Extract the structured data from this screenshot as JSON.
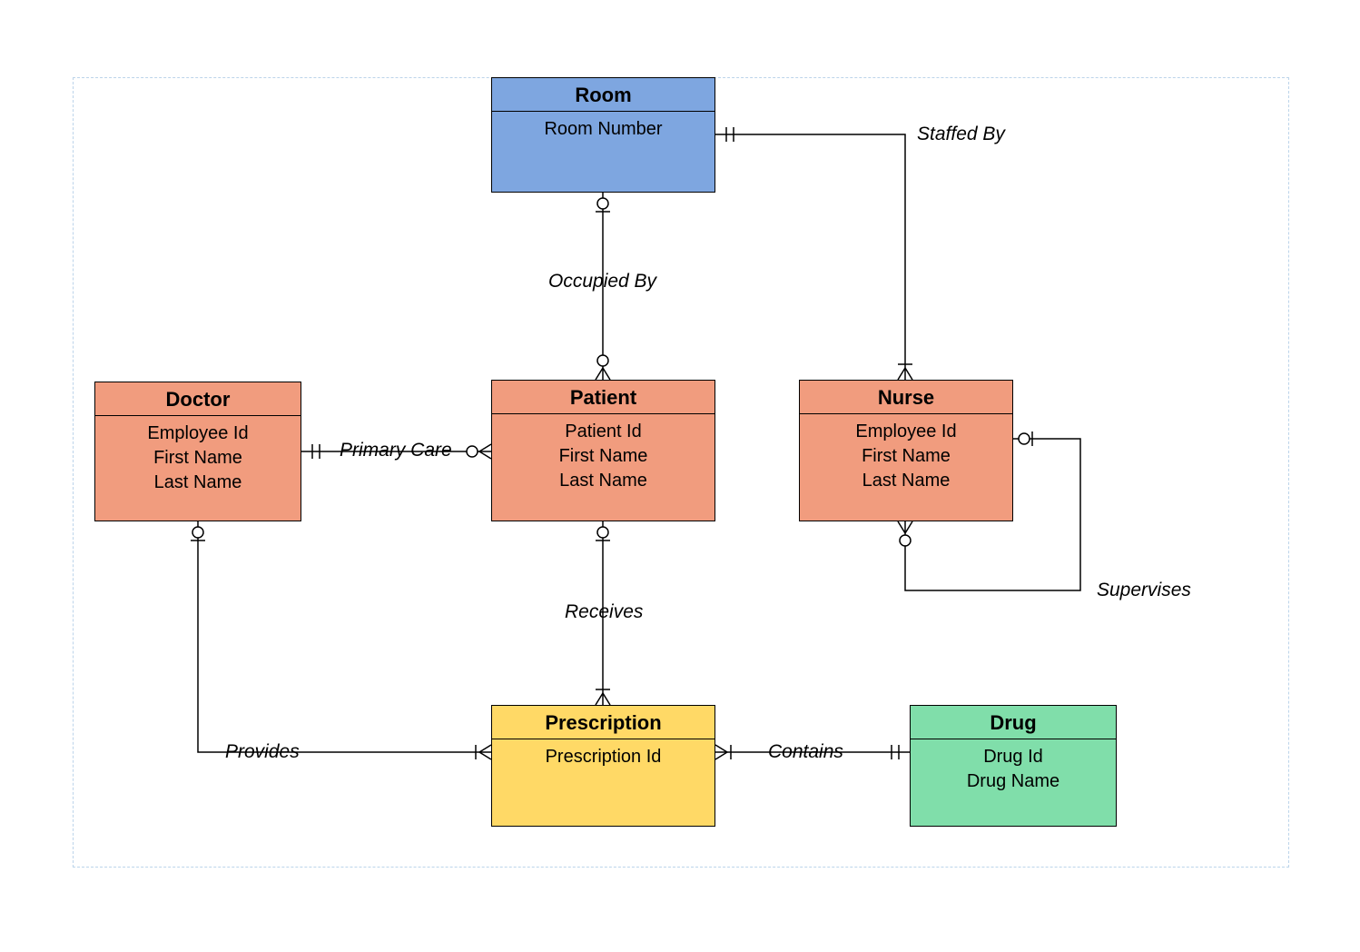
{
  "diagram": {
    "type": "ER diagram",
    "entities": {
      "room": {
        "title": "Room",
        "attributes": [
          "Room Number"
        ],
        "color": "#7ea6e0"
      },
      "doctor": {
        "title": "Doctor",
        "attributes": [
          "Employee Id",
          "First Name",
          "Last Name"
        ],
        "color": "#f19c7e"
      },
      "patient": {
        "title": "Patient",
        "attributes": [
          "Patient Id",
          "First Name",
          "Last Name"
        ],
        "color": "#f19c7e"
      },
      "nurse": {
        "title": "Nurse",
        "attributes": [
          "Employee Id",
          "First Name",
          "Last Name"
        ],
        "color": "#f19c7e"
      },
      "prescription": {
        "title": "Prescription",
        "attributes": [
          "Prescription Id"
        ],
        "color": "#ffd966"
      },
      "drug": {
        "title": "Drug",
        "attributes": [
          "Drug Id",
          "Drug Name"
        ],
        "color": "#80deaa"
      }
    },
    "relationships": {
      "staffedBy": {
        "label": "Staffed By",
        "from": "room",
        "to": "nurse",
        "from_card": "one-and-only-one",
        "to_card": "one-or-many"
      },
      "occupiedBy": {
        "label": "Occupied By",
        "from": "room",
        "to": "patient",
        "from_card": "zero-or-one",
        "to_card": "zero-or-many"
      },
      "primaryCare": {
        "label": "Primary Care",
        "from": "doctor",
        "to": "patient",
        "from_card": "one-and-only-one",
        "to_card": "zero-or-many"
      },
      "receives": {
        "label": "Receives",
        "from": "patient",
        "to": "prescription",
        "from_card": "zero-or-one",
        "to_card": "one-or-many"
      },
      "provides": {
        "label": "Provides",
        "from": "doctor",
        "to": "prescription",
        "from_card": "zero-or-one",
        "to_card": "one-or-many"
      },
      "contains": {
        "label": "Contains",
        "from": "drug",
        "to": "prescription",
        "from_card": "one-and-only-one",
        "to_card": "one-or-many"
      },
      "supervises": {
        "label": "Supervises",
        "from": "nurse",
        "to": "nurse",
        "from_card": "zero-or-one",
        "to_card": "zero-or-many"
      }
    }
  }
}
